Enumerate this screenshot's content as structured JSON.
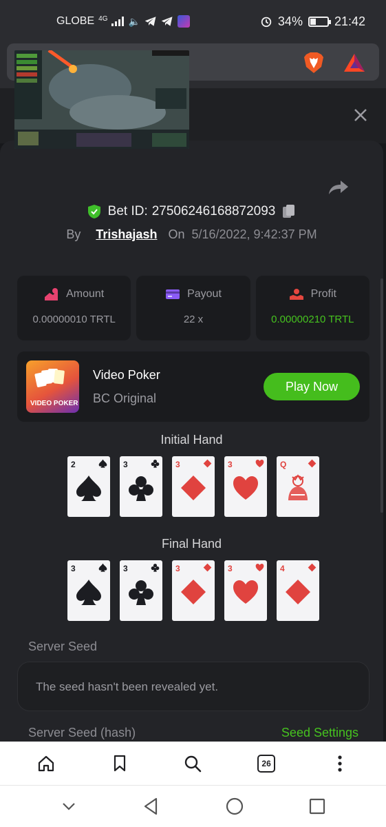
{
  "status_bar": {
    "carrier": "GLOBE",
    "network": "4G",
    "battery_percent": "34%",
    "battery_level": 0.34,
    "time": "21:42"
  },
  "modal": {
    "bet_id_label": "Bet ID:",
    "bet_id": "27506246168872093",
    "by_label": "By",
    "user": "Trishajash",
    "on_label": "On",
    "date": "5/16/2022, 9:42:37 PM"
  },
  "stats": [
    {
      "label": "Amount",
      "value": "0.00000010 TRTL",
      "icon": "amount-icon",
      "color": "#e8426f"
    },
    {
      "label": "Payout",
      "value": "22 x",
      "icon": "card-icon",
      "color": "#8b5cf6"
    },
    {
      "label": "Profit",
      "value": "0.00000210 TRTL",
      "icon": "profit-icon",
      "color": "#e5473f"
    }
  ],
  "game": {
    "thumb_text": "VIDEO POKER",
    "title": "Video Poker",
    "subtitle": "BC Original",
    "play_label": "Play Now"
  },
  "hands": {
    "initial_label": "Initial Hand",
    "initial": [
      {
        "rank": "2",
        "suit": "spade"
      },
      {
        "rank": "3",
        "suit": "club"
      },
      {
        "rank": "3",
        "suit": "diamond"
      },
      {
        "rank": "3",
        "suit": "heart"
      },
      {
        "rank": "Q",
        "suit": "diamond"
      }
    ],
    "final_label": "Final Hand",
    "final": [
      {
        "rank": "3",
        "suit": "spade"
      },
      {
        "rank": "3",
        "suit": "club"
      },
      {
        "rank": "3",
        "suit": "diamond"
      },
      {
        "rank": "3",
        "suit": "heart"
      },
      {
        "rank": "4",
        "suit": "diamond"
      }
    ]
  },
  "seed": {
    "server_seed_label": "Server Seed",
    "server_seed_value": "The seed hasn't been revealed yet.",
    "hash_label": "Server Seed (hash)",
    "settings_label": "Seed Settings"
  },
  "bottom_nav": {
    "tab_count": "26"
  },
  "colors": {
    "accent_green": "#45bd1d",
    "panel_bg": "#232428"
  }
}
